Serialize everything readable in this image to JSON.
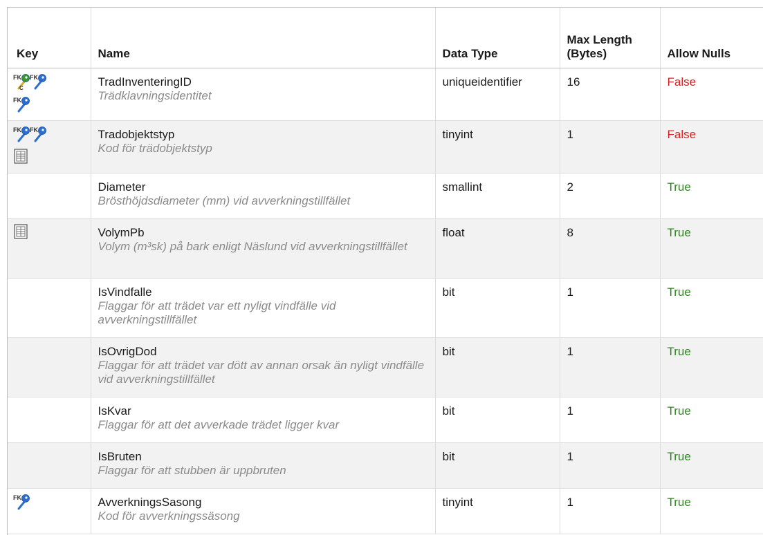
{
  "headers": {
    "key": "Key",
    "name": "Name",
    "data_type": "Data Type",
    "max_length": "Max Length (Bytes)",
    "allow_nulls": "Allow Nulls"
  },
  "icon_labels": {
    "fk": "FK",
    "c": "C"
  },
  "colors": {
    "false": "#e02020",
    "true": "#2a8a1a",
    "description": "#8a8a8a"
  },
  "rows": [
    {
      "keys": [
        "pk-fk-key-icon",
        "fk-key-icon",
        "fk-key-icon"
      ],
      "name": "TradInventeringID",
      "description": "Trädklavningsidentitet",
      "type": "uniqueidentifier",
      "length": "16",
      "nulls": "False"
    },
    {
      "keys": [
        "fk-key-icon",
        "fk-key-icon",
        "table-icon"
      ],
      "name": "Tradobjektstyp",
      "description": "Kod för trädobjektstyp",
      "type": "tinyint",
      "length": "1",
      "nulls": "False"
    },
    {
      "keys": [],
      "name": "Diameter",
      "description": "Brösthöjdsdiameter (mm) vid avverkningstillfället",
      "type": "smallint",
      "length": "2",
      "nulls": "True"
    },
    {
      "keys": [
        "table-icon"
      ],
      "name": "VolymPb",
      "description": "Volym (m³sk) på bark enligt Näslund vid avverkningstillfället",
      "type": "float",
      "length": "8",
      "nulls": "True"
    },
    {
      "keys": [],
      "name": "IsVindfalle",
      "description": "Flaggar för att trädet var ett nyligt vindfälle vid avverkningstillfället",
      "type": "bit",
      "length": "1",
      "nulls": "True"
    },
    {
      "keys": [],
      "name": "IsOvrigDod",
      "description": "Flaggar för att trädet var dött av annan orsak än nyligt vindfälle vid avverkningstillfället",
      "type": "bit",
      "length": "1",
      "nulls": "True"
    },
    {
      "keys": [],
      "name": "IsKvar",
      "description": "Flaggar för att det avverkade trädet ligger kvar",
      "type": "bit",
      "length": "1",
      "nulls": "True"
    },
    {
      "keys": [],
      "name": "IsBruten",
      "description": "Flaggar för att stubben är uppbruten",
      "type": "bit",
      "length": "1",
      "nulls": "True"
    },
    {
      "keys": [
        "fk-key-icon"
      ],
      "name": "AvverkningsSasong",
      "description": "Kod för avverkningssäsong",
      "type": "tinyint",
      "length": "1",
      "nulls": "True"
    }
  ]
}
